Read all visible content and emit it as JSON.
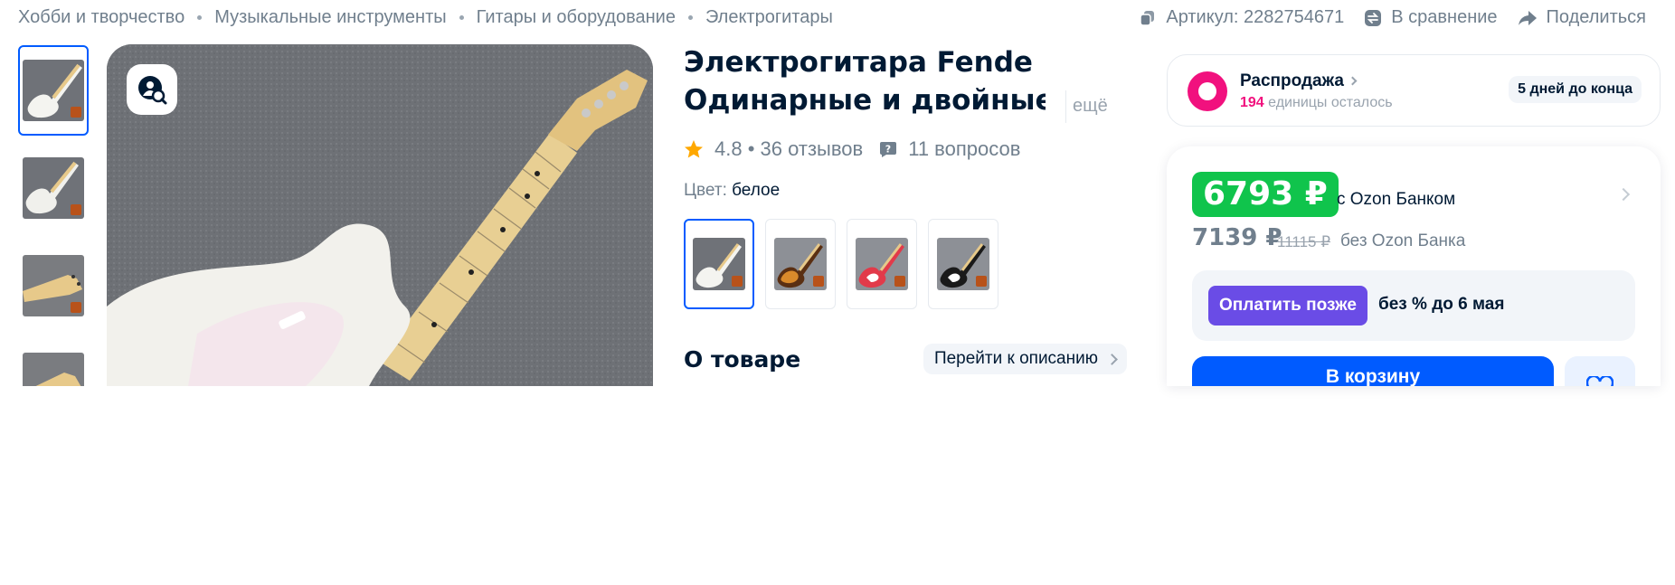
{
  "breadcrumb": {
    "items": [
      "Хобби и творчество",
      "Музыкальные инструменты",
      "Гитары и оборудование",
      "Электрогитары"
    ]
  },
  "actions": {
    "article": "Артикул: 2282754671",
    "compare": "В сравнение",
    "share": "Поделиться"
  },
  "product": {
    "title_line1": "Электрогитара Fende",
    "title_line2": "Одинарные и двойные...",
    "more": "ещё",
    "rating": "4.8",
    "reviews": "36 отзывов",
    "questions": "11 вопросов",
    "color_label": "Цвет:",
    "color_value": "белое",
    "variant_colors": [
      "white",
      "sunburst",
      "red",
      "black"
    ],
    "about_title": "О товаре",
    "goto_description": "Перейти к описанию"
  },
  "sale": {
    "title": "Распродажа",
    "count": "194",
    "remaining": "единицы осталось",
    "days_left": "5 дней до конца"
  },
  "price": {
    "card_price": "6793 ₽",
    "with_bank": "с Ozon Банком",
    "regular_price": "7139 ₽",
    "old_price": "11115 ₽",
    "without_bank": "без Ozon Банка",
    "pay_later": "Оплатить позже",
    "pay_later_terms": "без % до 6 мая",
    "add_to_cart": "В корзину"
  },
  "colors": {
    "accent_blue": "#005bff",
    "price_green": "#10c44c",
    "sale_pink": "#f1117e",
    "pay_later_purple": "#6a4ce6",
    "rating_star": "#ffa800"
  },
  "icons": [
    "copy-icon",
    "compare-icon",
    "share-icon",
    "photo-search-icon",
    "star-icon",
    "question-icon",
    "sale-logo-icon",
    "heart-icon"
  ]
}
